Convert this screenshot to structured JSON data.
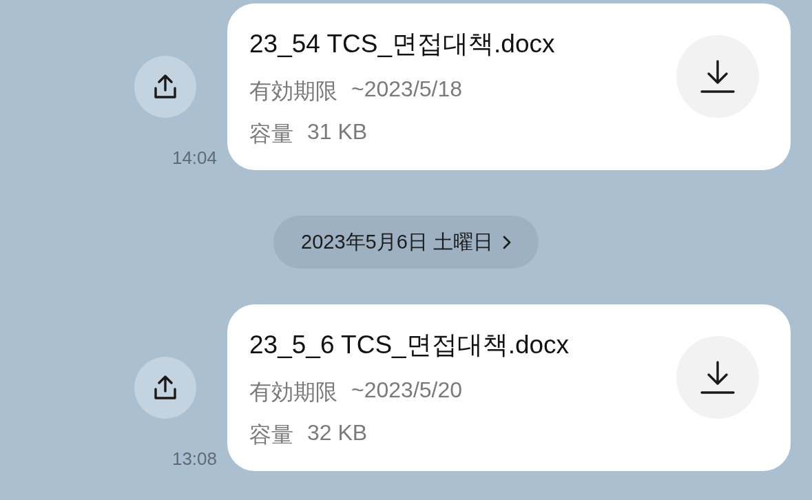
{
  "timeline": [
    {
      "kind": "file",
      "file_name": "23_54 TCS_면접대책.docx",
      "expiry_label": "有効期限",
      "expiry": "~2023/5/18",
      "size_label": "容量",
      "size": "31 KB",
      "time": "14:04"
    },
    {
      "kind": "date",
      "label": "2023年5月6日 土曜日"
    },
    {
      "kind": "file",
      "file_name": "23_5_6 TCS_면접대책.docx",
      "expiry_label": "有効期限",
      "expiry": "~2023/5/20",
      "size_label": "容量",
      "size": "32 KB",
      "time": "13:08"
    }
  ]
}
